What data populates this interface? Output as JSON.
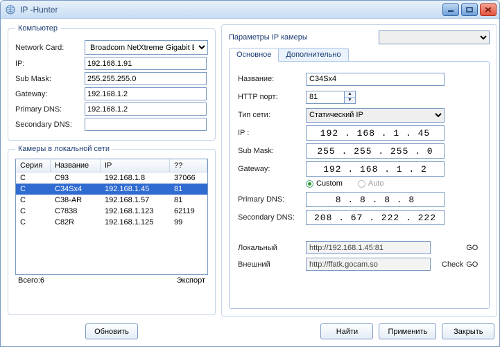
{
  "window": {
    "title": "IP -Hunter"
  },
  "computer": {
    "legend": "Компьютер",
    "network_card_label": "Network Card:",
    "network_card_value": "Broadcom NetXtreme Gigabit Ethe",
    "ip_label": "IP:",
    "ip_value": "192.168.1.91",
    "submask_label": "Sub Mask:",
    "submask_value": "255.255.255.0",
    "gateway_label": "Gateway:",
    "gateway_value": "192.168.1.2",
    "pdns_label": "Primary DNS:",
    "pdns_value": "192.168.1.2",
    "sdns_label": "Secondary DNS:",
    "sdns_value": ""
  },
  "cameras": {
    "legend": "Камеры в локальной сети",
    "headers": {
      "serial": "Серия",
      "name": "Название",
      "ip": "IP",
      "unk": "??"
    },
    "rows": [
      {
        "serial": "C",
        "name": "C93",
        "ip": "192.168.1.8",
        "port": "37066"
      },
      {
        "serial": "C",
        "name": "C34Sx4",
        "ip": "192.168.1.45",
        "port": "81"
      },
      {
        "serial": "C",
        "name": "C38-AR",
        "ip": "192.168.1.57",
        "port": "81"
      },
      {
        "serial": "C",
        "name": "C7838",
        "ip": "192.168.1.123",
        "port": "62119"
      },
      {
        "serial": "C",
        "name": "C82R",
        "ip": "192.168.1.125",
        "port": "99"
      }
    ],
    "selected_index": 1,
    "total_label": "Всего:6",
    "export_label": "Экспорт",
    "refresh_label": "Обновить"
  },
  "params": {
    "legend": "Параметры IP камеры",
    "dropdown_value": "",
    "tabs": {
      "basic": "Основное",
      "advanced": "Дополнительно"
    },
    "name_label": "Название:",
    "name_value": "C34Sx4",
    "http_port_label": "HTTP порт:",
    "http_port_value": "81",
    "nettype_label": "Тип сети:",
    "nettype_value": "Статический IP",
    "ip_label": "IP  :",
    "ip_value": "192 . 168 .  1  . 45",
    "submask_label": "Sub Mask:",
    "submask_value": "255 . 255 . 255 .  0",
    "gateway_label": "Gateway:",
    "gateway_value": "192 . 168 .  1  .  2",
    "radio_custom": "Custom",
    "radio_auto": "Auto",
    "pdns_label": "Primary DNS:",
    "pdns_value": "8  .  8  .  8  .  8",
    "sdns_label": "Secondary DNS:",
    "sdns_value": "208 . 67  . 222 . 222",
    "local_label": "Локальный",
    "local_url": "http://192.168.1.45:81",
    "external_label": "Внешний",
    "external_url": "http://ffatk.gocam.so",
    "go_label": "GO",
    "check_label": "Check"
  },
  "buttons": {
    "find": "Найти",
    "apply": "Применить",
    "close": "Закрыть"
  }
}
